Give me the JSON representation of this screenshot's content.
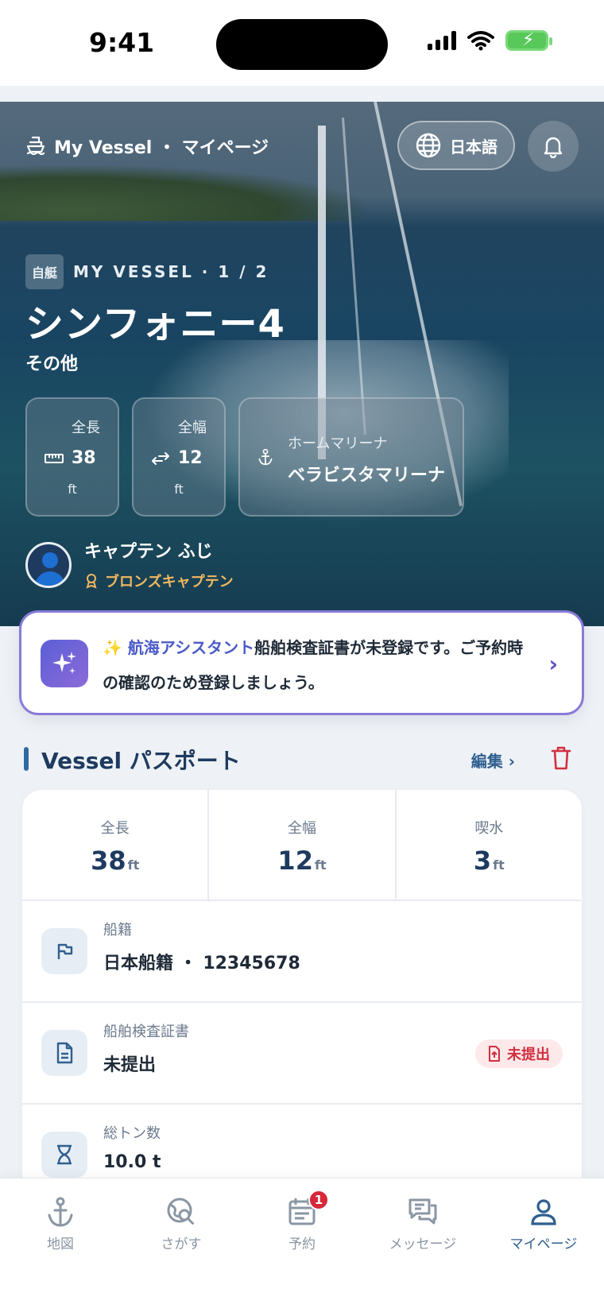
{
  "status_bar": {
    "time": "9:41"
  },
  "header": {
    "title": "My Vessel ・ マイページ",
    "language": "日本語"
  },
  "hero": {
    "tag": "自艇",
    "vessel_counter": "MY VESSEL · 1 / 2",
    "vessel_name": "シンフォニー4",
    "vessel_type": "その他",
    "length": {
      "label": "全長",
      "value": "38",
      "unit": "ft"
    },
    "beam": {
      "label": "全幅",
      "value": "12",
      "unit": "ft"
    },
    "marina": {
      "label": "ホームマリーナ",
      "value": "ベラビスタマリーナ"
    },
    "captain": {
      "name": "キャプテン ふじ",
      "rank": "ブロンズキャプテン"
    }
  },
  "assistant": {
    "name": "航海アシスタント",
    "message": "船舶検査証書が未登録です。ご予約時の確認のため登録しましょう。"
  },
  "passport": {
    "title": "Vessel パスポート",
    "edit_label": "編集",
    "dims": [
      {
        "label": "全長",
        "value": "38",
        "unit": "ft"
      },
      {
        "label": "全幅",
        "value": "12",
        "unit": "ft"
      },
      {
        "label": "喫水",
        "value": "3",
        "unit": "ft"
      }
    ],
    "registry": {
      "label": "船籍",
      "value": "日本船籍 ・ 12345678"
    },
    "inspection": {
      "label": "船舶検査証書",
      "value": "未提出",
      "badge": "未提出"
    },
    "tonnage": {
      "label": "総トン数",
      "value": "10.0 t"
    }
  },
  "tabs": [
    {
      "label": "地図",
      "icon": "anchor-icon",
      "active": false
    },
    {
      "label": "さがす",
      "icon": "search-globe-icon",
      "active": false
    },
    {
      "label": "予約",
      "icon": "calendar-icon",
      "active": false,
      "badge": "1"
    },
    {
      "label": "メッセージ",
      "icon": "chat-icon",
      "active": false
    },
    {
      "label": "マイページ",
      "icon": "user-icon",
      "active": true
    }
  ],
  "colors": {
    "accent": "#2f5f8f",
    "assistant_border": "#8a7ad8",
    "missing_badge": "#d1303f",
    "rank_gold": "#f0b860"
  }
}
